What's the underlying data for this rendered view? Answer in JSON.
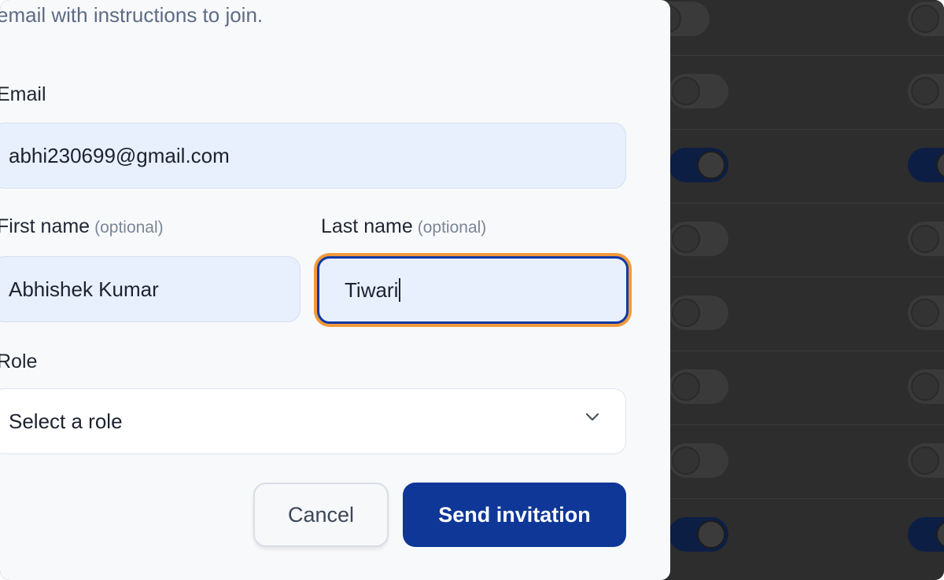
{
  "dialog": {
    "intro_text": "email with instructions to join.",
    "email": {
      "label": "Email",
      "value": "abhi230699@gmail.com"
    },
    "first_name": {
      "label": "First name",
      "optional": "(optional)",
      "value": "Abhishek Kumar"
    },
    "last_name": {
      "label": "Last name",
      "optional": "(optional)",
      "value": "Tiwari"
    },
    "role": {
      "label": "Role",
      "placeholder": "Select a role"
    },
    "buttons": {
      "cancel": "Cancel",
      "send": "Send invitation"
    }
  },
  "icons": {
    "role_dropdown": "chevron-down-icon",
    "toggle": "toggle-switch"
  },
  "colors": {
    "primary": "#0e3797",
    "focus_highlight": "#f2993a",
    "input_background": "#e8f0fe",
    "overlay": "#2d2d2d"
  }
}
